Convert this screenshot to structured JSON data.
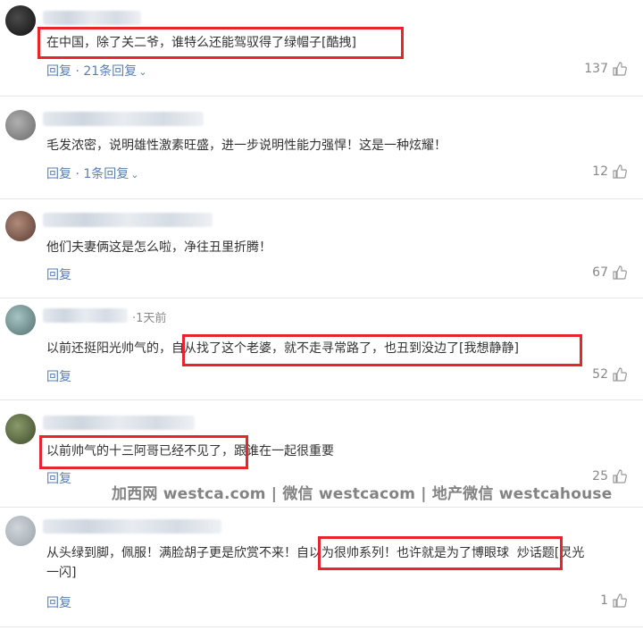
{
  "comments": [
    {
      "text": "在中国，除了关二爷，谁特么还能驾驭得了绿帽子[酷拽]",
      "reply_label": "回复",
      "replies_label": "21条回复",
      "likes": "137"
    },
    {
      "text": "毛发浓密，说明雄性激素旺盛，进一步说明性能力强悍！这是一种炫耀！",
      "reply_label": "回复",
      "replies_label": "1条回复",
      "likes": "12"
    },
    {
      "text": "他们夫妻俩这是怎么啦，净往丑里折腾！",
      "reply_label": "回复",
      "likes": "67"
    },
    {
      "name_fragment": "·1天前",
      "text_a": "以前还挺阳光帅气的，",
      "text_b": "自从找了这个老婆，就不走寻常路了，也丑到没边了[我想静静]",
      "reply_label": "回复",
      "likes": "52"
    },
    {
      "text_a": "以前帅气的十三阿哥已经不见了，",
      "text_b": "跟谁在一起很重要",
      "reply_label": "回复",
      "likes": "25"
    },
    {
      "text_a": "从头绿到脚，佩服！满脸胡子更是欣赏不来！",
      "text_b": "自以为很帅系列！也许就是为了博眼球",
      "text_c": "炒话题[灵光",
      "text_d": "一闪]",
      "reply_label": "回复",
      "likes": "1"
    }
  ],
  "watermark": "加西网 westca.com | 微信 westcacom | 地产微信 westcahouse",
  "icons": {
    "like": "thumbs-up-icon",
    "expand": "chevron-down-icon"
  },
  "colors": {
    "link": "#5a7fb6",
    "highlight": "#e8242c",
    "text": "#333333"
  }
}
